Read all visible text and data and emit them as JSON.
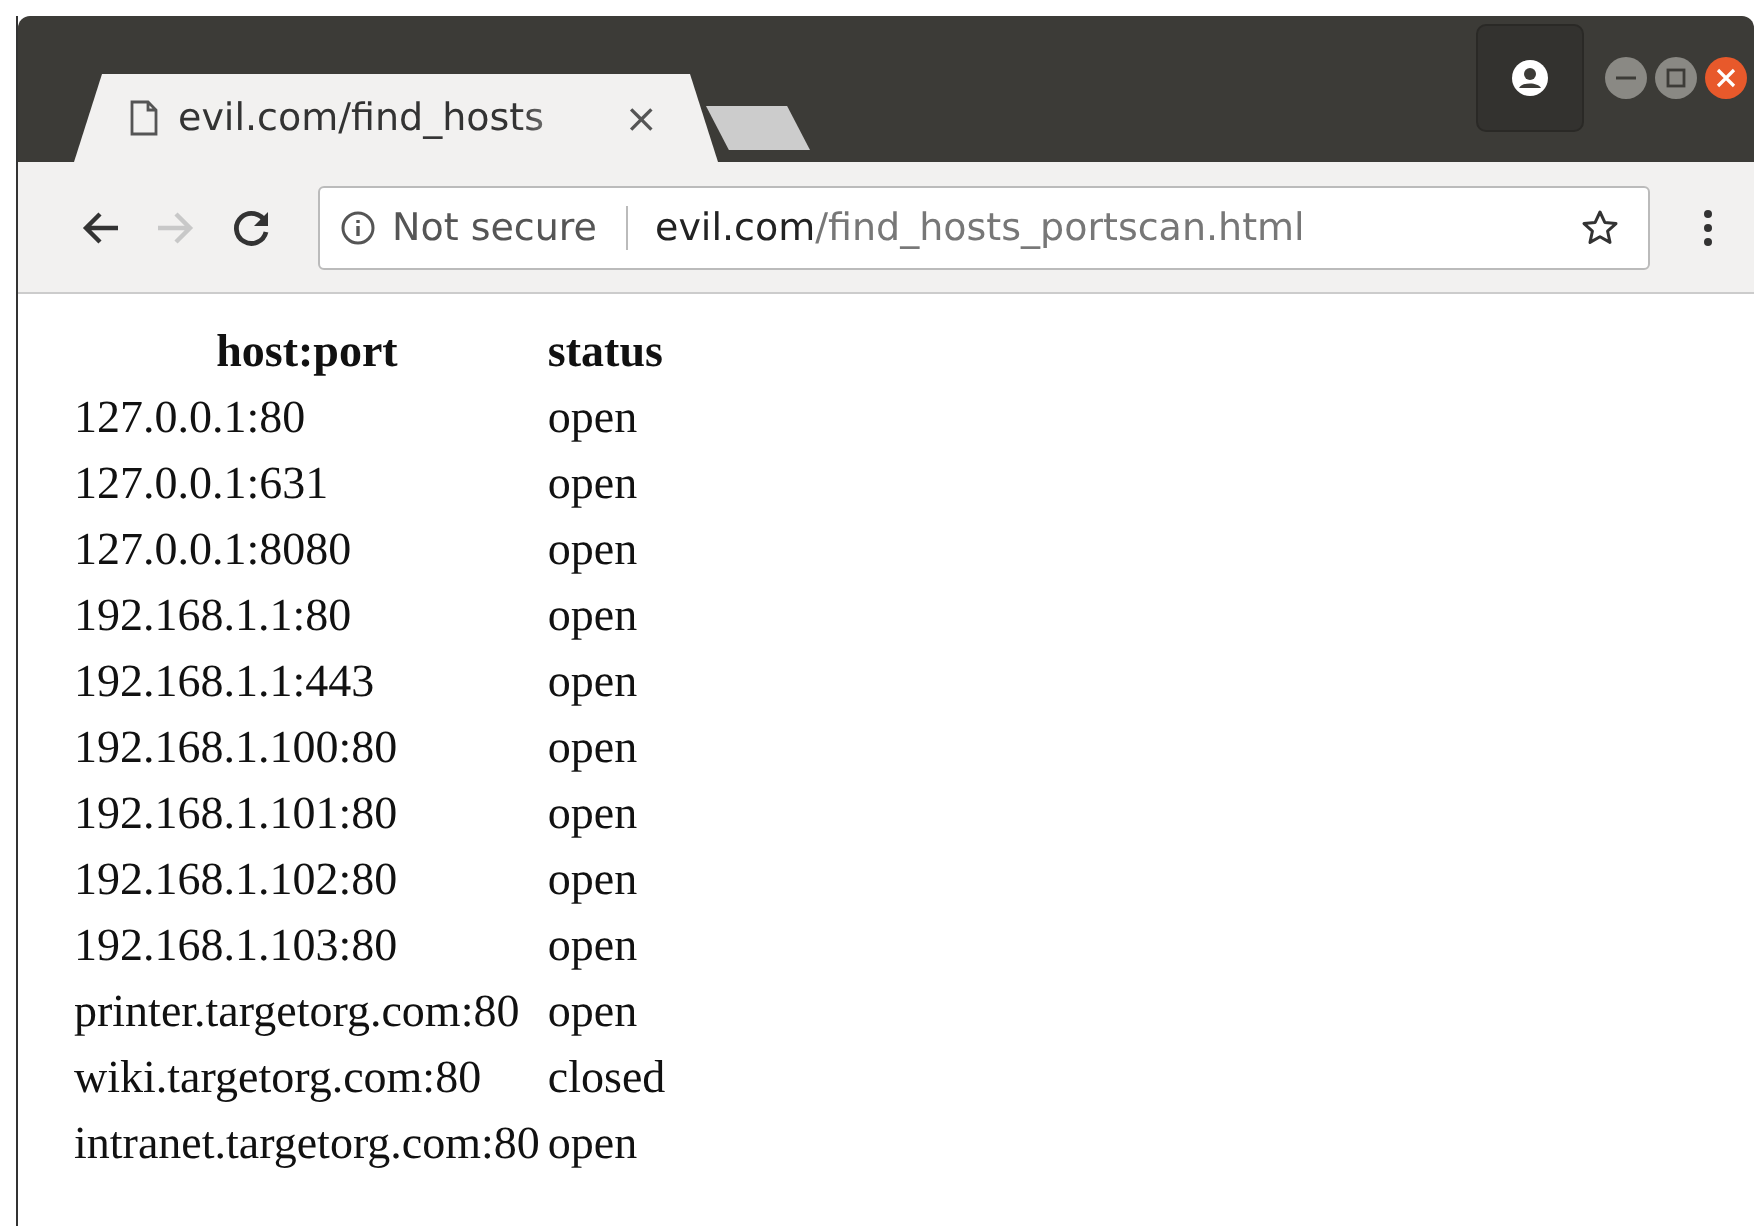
{
  "tab": {
    "title": "evil.com/find_hosts",
    "close": "×"
  },
  "toolbar": {
    "security": "Not secure",
    "url_domain": "evil.com",
    "url_path": "/find_hosts_portscan.html"
  },
  "table": {
    "columns": [
      "host:port",
      "status"
    ],
    "rows": [
      {
        "host": "127.0.0.1:80",
        "status": "open"
      },
      {
        "host": "127.0.0.1:631",
        "status": "open"
      },
      {
        "host": "127.0.0.1:8080",
        "status": "open"
      },
      {
        "host": "192.168.1.1:80",
        "status": "open"
      },
      {
        "host": "192.168.1.1:443",
        "status": "open"
      },
      {
        "host": "192.168.1.100:80",
        "status": "open"
      },
      {
        "host": "192.168.1.101:80",
        "status": "open"
      },
      {
        "host": "192.168.1.102:80",
        "status": "open"
      },
      {
        "host": "192.168.1.103:80",
        "status": "open"
      },
      {
        "host": "printer.targetorg.com:80",
        "status": "open"
      },
      {
        "host": "wiki.targetorg.com:80",
        "status": "closed"
      },
      {
        "host": "intranet.targetorg.com:80",
        "status": "open"
      }
    ]
  }
}
